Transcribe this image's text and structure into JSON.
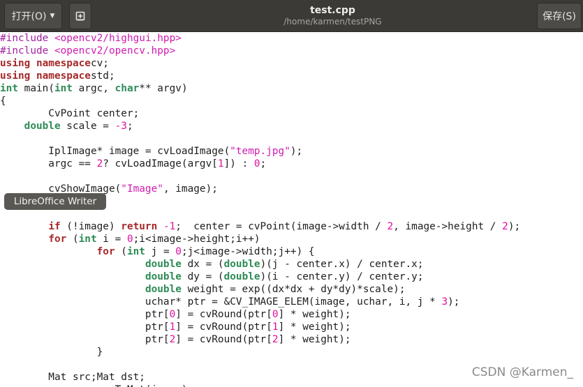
{
  "header": {
    "open_label": "打开(O)",
    "save_label": "保存(S)",
    "title": "test.cpp",
    "subtitle": "/home/karmen/testPNG"
  },
  "tooltip": "LibreOffice Writer",
  "watermark": "CSDN @Karmen_",
  "colors": {
    "preprocessor": "#a020a0",
    "keyword": "#a52a2a",
    "type": "#2e8b57",
    "number": "#e0109f",
    "string": "#d01bb0",
    "headerbar": "#3b3a37"
  },
  "code": [
    [
      [
        "pp",
        "#include "
      ],
      [
        "inc",
        "<opencv2/highgui.hpp>"
      ]
    ],
    [
      [
        "pp",
        "#include "
      ],
      [
        "inc",
        "<opencv2/opencv.hpp>"
      ]
    ],
    [
      [
        "kw",
        "using namespace"
      ],
      [
        "",
        "cv;"
      ]
    ],
    [
      [
        "kw",
        "using namespace"
      ],
      [
        "",
        "std;"
      ]
    ],
    [
      [
        "ty",
        "int"
      ],
      [
        "",
        " main("
      ],
      [
        "ty",
        "int"
      ],
      [
        "",
        " argc, "
      ],
      [
        "ty",
        "char"
      ],
      [
        "",
        "** argv)"
      ]
    ],
    [
      [
        "",
        "{"
      ]
    ],
    [
      [
        "",
        "        CvPoint center;"
      ]
    ],
    [
      [
        "",
        "    "
      ],
      [
        "ty",
        "double"
      ],
      [
        "",
        " scale = "
      ],
      [
        "num",
        "-3"
      ],
      [
        "",
        ";"
      ]
    ],
    [
      [
        "",
        ""
      ]
    ],
    [
      [
        "",
        "        IplImage* image = cvLoadImage("
      ],
      [
        "str",
        "\"temp.jpg\""
      ],
      [
        "",
        ");"
      ]
    ],
    [
      [
        "",
        "        argc == "
      ],
      [
        "num",
        "2"
      ],
      [
        "",
        "? cvLoadImage(argv["
      ],
      [
        "num",
        "1"
      ],
      [
        "",
        "]) : "
      ],
      [
        "num",
        "0"
      ],
      [
        "",
        ";"
      ]
    ],
    [
      [
        "",
        ""
      ]
    ],
    [
      [
        "",
        "        cvShowImage("
      ],
      [
        "str",
        "\"Image\""
      ],
      [
        "",
        ", image);"
      ]
    ],
    [
      [
        "",
        ""
      ]
    ],
    [
      [
        "",
        ""
      ]
    ],
    [
      [
        "",
        "        "
      ],
      [
        "kw",
        "if"
      ],
      [
        "",
        " (!image) "
      ],
      [
        "kw",
        "return"
      ],
      [
        "",
        " "
      ],
      [
        "num",
        "-1"
      ],
      [
        "",
        ";  center = cvPoint(image->width / "
      ],
      [
        "num",
        "2"
      ],
      [
        "",
        ", image->height / "
      ],
      [
        "num",
        "2"
      ],
      [
        "",
        ");"
      ]
    ],
    [
      [
        "",
        "        "
      ],
      [
        "kw",
        "for"
      ],
      [
        "",
        " ("
      ],
      [
        "ty",
        "int"
      ],
      [
        "",
        " i = "
      ],
      [
        "num",
        "0"
      ],
      [
        "",
        ";i<image->height;i++)"
      ]
    ],
    [
      [
        "",
        "                "
      ],
      [
        "kw",
        "for"
      ],
      [
        "",
        " ("
      ],
      [
        "ty",
        "int"
      ],
      [
        "",
        " j = "
      ],
      [
        "num",
        "0"
      ],
      [
        "",
        ";j<image->width;j++) {"
      ]
    ],
    [
      [
        "",
        "                        "
      ],
      [
        "ty",
        "double"
      ],
      [
        "",
        " dx = ("
      ],
      [
        "ty",
        "double"
      ],
      [
        "",
        ")(j - center.x) / center.x;"
      ]
    ],
    [
      [
        "",
        "                        "
      ],
      [
        "ty",
        "double"
      ],
      [
        "",
        " dy = ("
      ],
      [
        "ty",
        "double"
      ],
      [
        "",
        ")(i - center.y) / center.y;"
      ]
    ],
    [
      [
        "",
        "                        "
      ],
      [
        "ty",
        "double"
      ],
      [
        "",
        " weight = exp((dx*dx + dy*dy)*scale);"
      ]
    ],
    [
      [
        "",
        "                        uchar* ptr = &CV_IMAGE_ELEM(image, uchar, i, j * "
      ],
      [
        "num",
        "3"
      ],
      [
        "",
        ");"
      ]
    ],
    [
      [
        "",
        "                        ptr["
      ],
      [
        "num",
        "0"
      ],
      [
        "",
        "] = cvRound(ptr["
      ],
      [
        "num",
        "0"
      ],
      [
        "",
        "] * weight);"
      ]
    ],
    [
      [
        "",
        "                        ptr["
      ],
      [
        "num",
        "1"
      ],
      [
        "",
        "] = cvRound(ptr["
      ],
      [
        "num",
        "1"
      ],
      [
        "",
        "] * weight);"
      ]
    ],
    [
      [
        "",
        "                        ptr["
      ],
      [
        "num",
        "2"
      ],
      [
        "",
        "] = cvRound(ptr["
      ],
      [
        "num",
        "2"
      ],
      [
        "",
        "] * weight);"
      ]
    ],
    [
      [
        "",
        "                }"
      ]
    ],
    [
      [
        "",
        ""
      ]
    ],
    [
      [
        "",
        "        Mat src;Mat dst;"
      ]
    ],
    [
      [
        "",
        "        src = cvarrToMat(image);"
      ]
    ]
  ]
}
